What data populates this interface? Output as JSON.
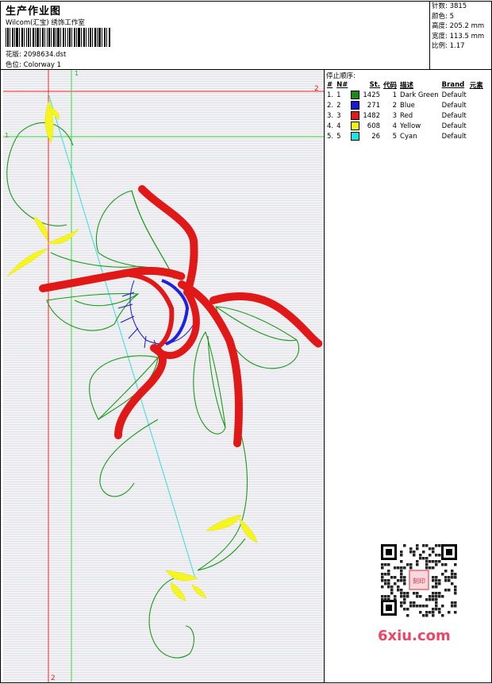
{
  "header": {
    "title": "生产作业图",
    "company": "Wilcom(汇宝) 绣饰工作室",
    "design_label": "花版:",
    "design_value": "2098634.dst",
    "colorway_label": "色位:",
    "colorway_value": "Colorway 1"
  },
  "stats": [
    {
      "label": "针数:",
      "value": "3815"
    },
    {
      "label": "颜色:",
      "value": "5"
    },
    {
      "label": "高度:",
      "value": "205.2 mm"
    },
    {
      "label": "宽度:",
      "value": "113.5 mm"
    },
    {
      "label": "比例:",
      "value": "1.17"
    }
  ],
  "legend": {
    "heading": "停止顺序:",
    "columns": [
      "#",
      "N#",
      "St.",
      "代码",
      "描述",
      "Brand",
      "元素"
    ],
    "rows": [
      {
        "idx": "1.",
        "n": "1",
        "color": "#1a8a1a",
        "st": "1425",
        "code": "1",
        "desc": "Dark Green",
        "brand": "Default"
      },
      {
        "idx": "2.",
        "n": "2",
        "color": "#1a1ad0",
        "st": "271",
        "code": "2",
        "desc": "Blue",
        "brand": "Default"
      },
      {
        "idx": "3.",
        "n": "3",
        "color": "#e01a1a",
        "st": "1482",
        "code": "3",
        "desc": "Red",
        "brand": "Default"
      },
      {
        "idx": "4.",
        "n": "4",
        "color": "#f0f010",
        "st": "608",
        "code": "4",
        "desc": "Yellow",
        "brand": "Default"
      },
      {
        "idx": "5.",
        "n": "5",
        "color": "#20e0e0",
        "st": "26",
        "code": "5",
        "desc": "Cyan",
        "brand": "Default"
      }
    ]
  },
  "guides": {
    "one": "1",
    "two": "2"
  },
  "watermark": "6xiu.com",
  "watermark_seal": "刻印"
}
